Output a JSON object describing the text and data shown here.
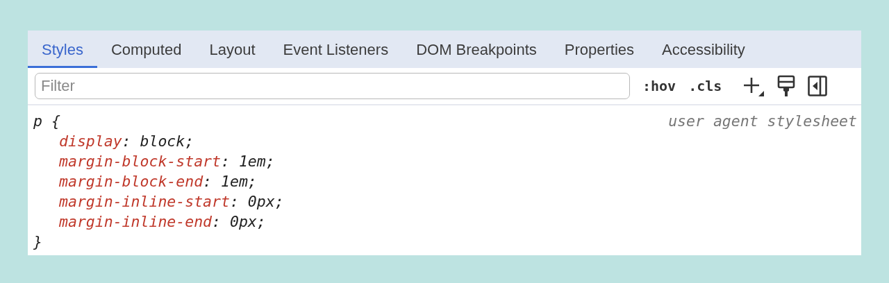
{
  "tabs": [
    {
      "label": "Styles",
      "selected": true
    },
    {
      "label": "Computed",
      "selected": false
    },
    {
      "label": "Layout",
      "selected": false
    },
    {
      "label": "Event Listeners",
      "selected": false
    },
    {
      "label": "DOM Breakpoints",
      "selected": false
    },
    {
      "label": "Properties",
      "selected": false
    },
    {
      "label": "Accessibility",
      "selected": false
    }
  ],
  "toolbar": {
    "filter": {
      "placeholder": "Filter"
    },
    "toggles": [
      ":hov",
      ".cls"
    ]
  },
  "rule": {
    "selector": "p {",
    "source": "user agent stylesheet",
    "declarations": [
      {
        "property": "display",
        "value": ": block;"
      },
      {
        "property": "margin-block-start",
        "value": ": 1em;"
      },
      {
        "property": "margin-block-end",
        "value": ": 1em;"
      },
      {
        "property": "margin-inline-start",
        "value": ": 0px;"
      },
      {
        "property": "margin-inline-end",
        "value": ": 0px;"
      }
    ],
    "closing": "}"
  }
}
